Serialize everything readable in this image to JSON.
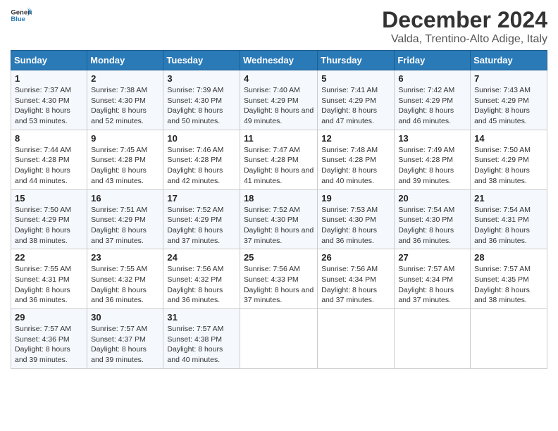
{
  "header": {
    "logo_general": "General",
    "logo_blue": "Blue",
    "title": "December 2024",
    "subtitle": "Valda, Trentino-Alto Adige, Italy"
  },
  "days_of_week": [
    "Sunday",
    "Monday",
    "Tuesday",
    "Wednesday",
    "Thursday",
    "Friday",
    "Saturday"
  ],
  "weeks": [
    [
      {
        "day": "1",
        "sunrise": "7:37 AM",
        "sunset": "4:30 PM",
        "daylight": "8 hours and 53 minutes."
      },
      {
        "day": "2",
        "sunrise": "7:38 AM",
        "sunset": "4:30 PM",
        "daylight": "8 hours and 52 minutes."
      },
      {
        "day": "3",
        "sunrise": "7:39 AM",
        "sunset": "4:30 PM",
        "daylight": "8 hours and 50 minutes."
      },
      {
        "day": "4",
        "sunrise": "7:40 AM",
        "sunset": "4:29 PM",
        "daylight": "8 hours and 49 minutes."
      },
      {
        "day": "5",
        "sunrise": "7:41 AM",
        "sunset": "4:29 PM",
        "daylight": "8 hours and 47 minutes."
      },
      {
        "day": "6",
        "sunrise": "7:42 AM",
        "sunset": "4:29 PM",
        "daylight": "8 hours and 46 minutes."
      },
      {
        "day": "7",
        "sunrise": "7:43 AM",
        "sunset": "4:29 PM",
        "daylight": "8 hours and 45 minutes."
      }
    ],
    [
      {
        "day": "8",
        "sunrise": "7:44 AM",
        "sunset": "4:28 PM",
        "daylight": "8 hours and 44 minutes."
      },
      {
        "day": "9",
        "sunrise": "7:45 AM",
        "sunset": "4:28 PM",
        "daylight": "8 hours and 43 minutes."
      },
      {
        "day": "10",
        "sunrise": "7:46 AM",
        "sunset": "4:28 PM",
        "daylight": "8 hours and 42 minutes."
      },
      {
        "day": "11",
        "sunrise": "7:47 AM",
        "sunset": "4:28 PM",
        "daylight": "8 hours and 41 minutes."
      },
      {
        "day": "12",
        "sunrise": "7:48 AM",
        "sunset": "4:28 PM",
        "daylight": "8 hours and 40 minutes."
      },
      {
        "day": "13",
        "sunrise": "7:49 AM",
        "sunset": "4:28 PM",
        "daylight": "8 hours and 39 minutes."
      },
      {
        "day": "14",
        "sunrise": "7:50 AM",
        "sunset": "4:29 PM",
        "daylight": "8 hours and 38 minutes."
      }
    ],
    [
      {
        "day": "15",
        "sunrise": "7:50 AM",
        "sunset": "4:29 PM",
        "daylight": "8 hours and 38 minutes."
      },
      {
        "day": "16",
        "sunrise": "7:51 AM",
        "sunset": "4:29 PM",
        "daylight": "8 hours and 37 minutes."
      },
      {
        "day": "17",
        "sunrise": "7:52 AM",
        "sunset": "4:29 PM",
        "daylight": "8 hours and 37 minutes."
      },
      {
        "day": "18",
        "sunrise": "7:52 AM",
        "sunset": "4:30 PM",
        "daylight": "8 hours and 37 minutes."
      },
      {
        "day": "19",
        "sunrise": "7:53 AM",
        "sunset": "4:30 PM",
        "daylight": "8 hours and 36 minutes."
      },
      {
        "day": "20",
        "sunrise": "7:54 AM",
        "sunset": "4:30 PM",
        "daylight": "8 hours and 36 minutes."
      },
      {
        "day": "21",
        "sunrise": "7:54 AM",
        "sunset": "4:31 PM",
        "daylight": "8 hours and 36 minutes."
      }
    ],
    [
      {
        "day": "22",
        "sunrise": "7:55 AM",
        "sunset": "4:31 PM",
        "daylight": "8 hours and 36 minutes."
      },
      {
        "day": "23",
        "sunrise": "7:55 AM",
        "sunset": "4:32 PM",
        "daylight": "8 hours and 36 minutes."
      },
      {
        "day": "24",
        "sunrise": "7:56 AM",
        "sunset": "4:32 PM",
        "daylight": "8 hours and 36 minutes."
      },
      {
        "day": "25",
        "sunrise": "7:56 AM",
        "sunset": "4:33 PM",
        "daylight": "8 hours and 37 minutes."
      },
      {
        "day": "26",
        "sunrise": "7:56 AM",
        "sunset": "4:34 PM",
        "daylight": "8 hours and 37 minutes."
      },
      {
        "day": "27",
        "sunrise": "7:57 AM",
        "sunset": "4:34 PM",
        "daylight": "8 hours and 37 minutes."
      },
      {
        "day": "28",
        "sunrise": "7:57 AM",
        "sunset": "4:35 PM",
        "daylight": "8 hours and 38 minutes."
      }
    ],
    [
      {
        "day": "29",
        "sunrise": "7:57 AM",
        "sunset": "4:36 PM",
        "daylight": "8 hours and 39 minutes."
      },
      {
        "day": "30",
        "sunrise": "7:57 AM",
        "sunset": "4:37 PM",
        "daylight": "8 hours and 39 minutes."
      },
      {
        "day": "31",
        "sunrise": "7:57 AM",
        "sunset": "4:38 PM",
        "daylight": "8 hours and 40 minutes."
      },
      null,
      null,
      null,
      null
    ]
  ]
}
